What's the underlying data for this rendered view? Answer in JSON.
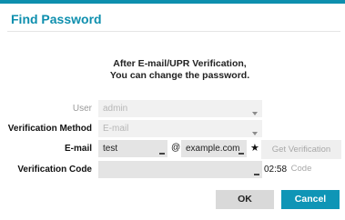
{
  "dialog": {
    "title": "Find Password",
    "accent_color": "#0e8fae",
    "message_line1": "After E-mail/UPR Verification,",
    "message_line2": "You can change the password."
  },
  "form": {
    "user_label": "User",
    "user_value": "admin",
    "method_label": "Verification Method",
    "method_value": "E-mail",
    "email_label": "E-mail",
    "email_local": "test",
    "email_at": "@",
    "email_domain": "example.com",
    "email_required_mark": "★",
    "get_code_label": "Get Verification Code",
    "code_label": "Verification Code",
    "code_value": "",
    "timer": "02:58"
  },
  "buttons": {
    "ok_label": "OK",
    "cancel_label": "Cancel",
    "cancel_color": "#0f95b6"
  }
}
